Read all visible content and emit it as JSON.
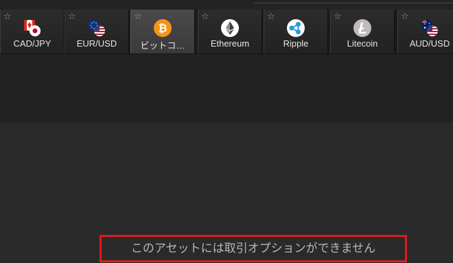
{
  "tabs": [
    {
      "label": "CAD/JPY",
      "icon": "cad-jpy-flags-icon",
      "star": "☆",
      "active": false
    },
    {
      "label": "EUR/USD",
      "icon": "eur-usd-flags-icon",
      "star": "☆",
      "active": false
    },
    {
      "label": "ビットコ…",
      "icon": "bitcoin-icon",
      "star": "☆",
      "active": true
    },
    {
      "label": "Ethereum",
      "icon": "ethereum-icon",
      "star": "☆",
      "active": false
    },
    {
      "label": "Ripple",
      "icon": "ripple-icon",
      "star": "☆",
      "active": false
    },
    {
      "label": "Litecoin",
      "icon": "litecoin-icon",
      "star": "☆",
      "active": false
    },
    {
      "label": "AUD/USD",
      "icon": "aud-usd-flags-icon",
      "star": "☆",
      "active": false
    }
  ],
  "notice": {
    "text": "このアセットには取引オプションができません"
  },
  "colors": {
    "bitcoin": "#f7931a",
    "ripple": "#2a9bd8",
    "highlight_border": "#e11a1a"
  }
}
